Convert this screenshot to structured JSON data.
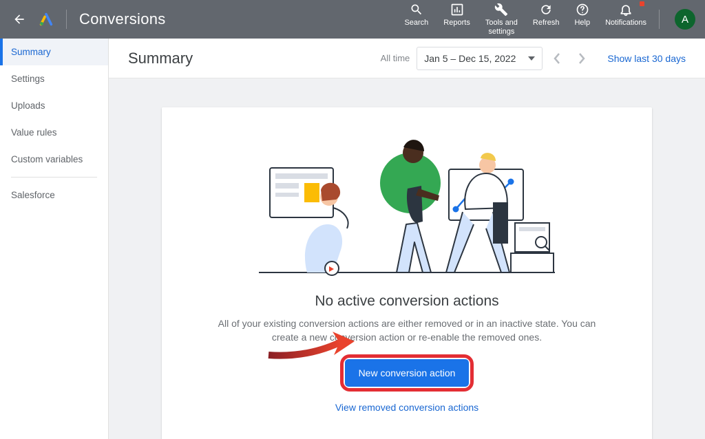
{
  "header": {
    "title": "Conversions",
    "tools": {
      "search": "Search",
      "reports": "Reports",
      "tools": "Tools and\nsettings",
      "refresh": "Refresh",
      "help": "Help",
      "notifications": "Notifications"
    },
    "avatar_letter": "A"
  },
  "sidebar": {
    "items": [
      "Summary",
      "Settings",
      "Uploads",
      "Value rules",
      "Custom variables",
      "Salesforce"
    ],
    "active_index": 0
  },
  "page": {
    "title": "Summary",
    "range_label": "All time",
    "date_range": "Jan 5 – Dec 15, 2022",
    "show_link": "Show last 30 days"
  },
  "empty_state": {
    "title": "No active conversion actions",
    "subtitle": "All of your existing conversion actions are either removed or in an inactive state. You can create a new conversion action or re-enable the removed ones.",
    "cta_label": "New conversion action",
    "removed_link": "View removed conversion actions"
  },
  "colors": {
    "accent": "#1a73e8",
    "highlight_ring": "#e32e34",
    "header_bg": "#62676e"
  }
}
